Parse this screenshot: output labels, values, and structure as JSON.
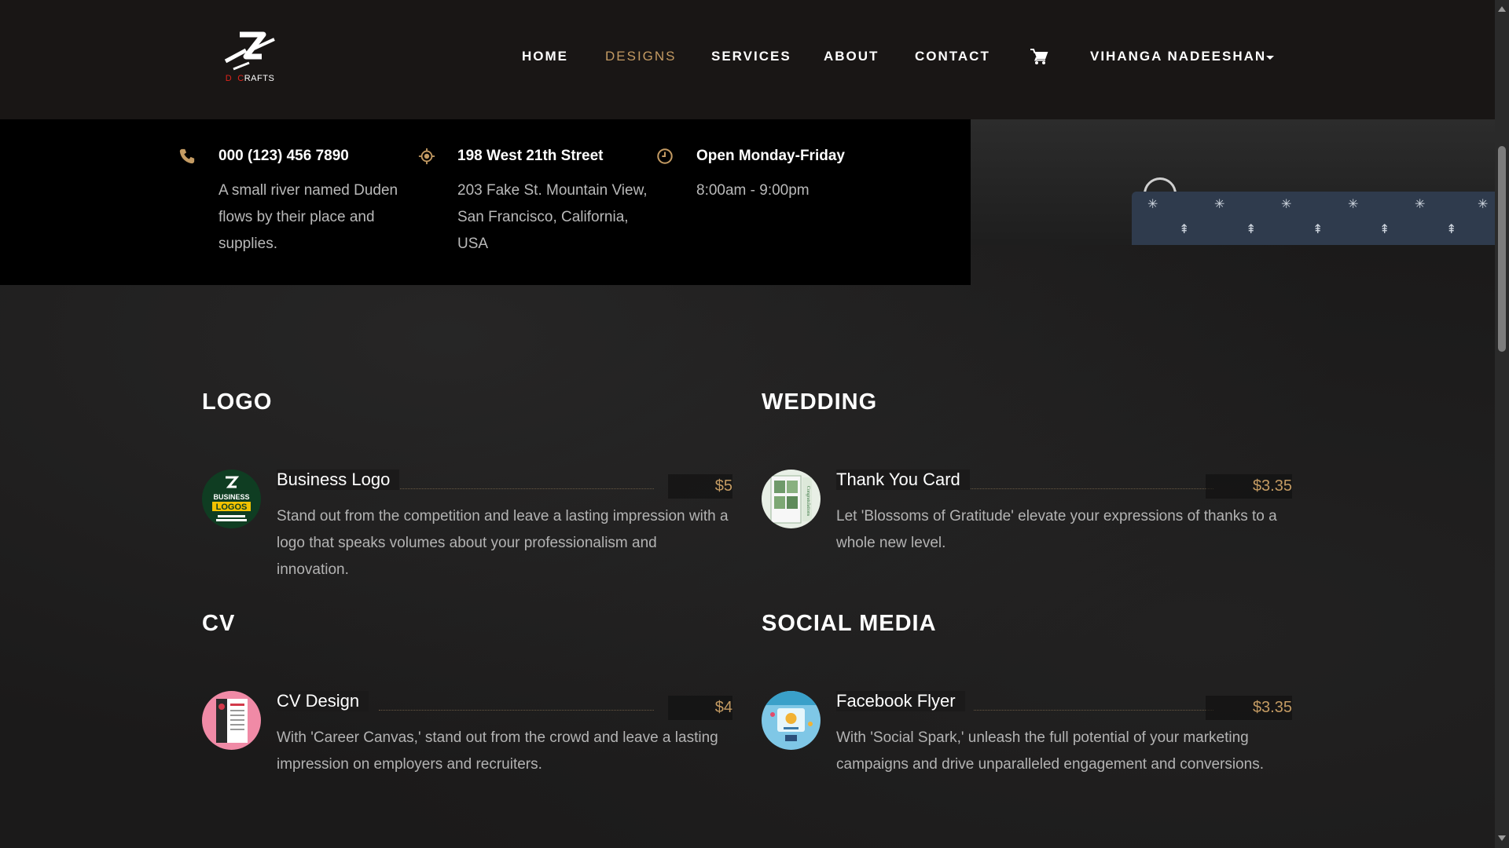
{
  "brand": {
    "logo_sub_prefix_1": "D",
    "logo_sub_prefix_2": "C",
    "logo_sub_rest": "RAFTS"
  },
  "nav": {
    "items": [
      {
        "label": "HOME",
        "active": false
      },
      {
        "label": "DESIGNS",
        "active": true
      },
      {
        "label": "SERVICES",
        "active": false
      },
      {
        "label": "ABOUT",
        "active": false
      },
      {
        "label": "CONTACT",
        "active": false
      }
    ],
    "user": "VIHANGA NADEESHAN",
    "cart_icon": "cart-icon"
  },
  "info": {
    "phone": {
      "title": "000 (123) 456 7890",
      "line1": "A small river named Duden",
      "line2": "flows by their place and",
      "line3": "supplies.",
      "icon": "phone-icon"
    },
    "address": {
      "title": "198 West 21th Street",
      "line1": "203 Fake St. Mountain View,",
      "line2": "San Francisco, California,",
      "line3": "USA",
      "icon": "location-icon"
    },
    "hours": {
      "title": "Open Monday-Friday",
      "line1": "8:00am - 9:00pm",
      "icon": "clock-icon"
    }
  },
  "sections": {
    "logo": {
      "title": "LOGO",
      "item": {
        "name": "Business Logo",
        "price": "$5",
        "desc": "Stand out from the competition and leave a lasting impression with a logo that speaks volumes about your professionalism and innovation.",
        "thumb_text": "BUSINESS LOGOS"
      }
    },
    "wedding": {
      "title": "WEDDING",
      "item": {
        "name": "Thank You Card",
        "price": "$3.35",
        "desc": "Let 'Blossoms of Gratitude' elevate your expressions of thanks to a whole new level."
      }
    },
    "cv": {
      "title": "CV",
      "item": {
        "name": "CV Design",
        "price": "$4",
        "desc": "With 'Career Canvas,' stand out from the crowd and leave a lasting impression on employers and recruiters."
      }
    },
    "social": {
      "title": "SOCIAL MEDIA",
      "item": {
        "name": "Facebook Flyer",
        "price": "$3.35",
        "desc": "With 'Social Spark,' unleash the full potential of your marketing campaigns and drive unparalleled engagement and conversions."
      }
    }
  },
  "colors": {
    "accent": "#c49b63",
    "header_bg": "#191615",
    "info_bg": "#000000",
    "brand_red": "#e0241b"
  }
}
